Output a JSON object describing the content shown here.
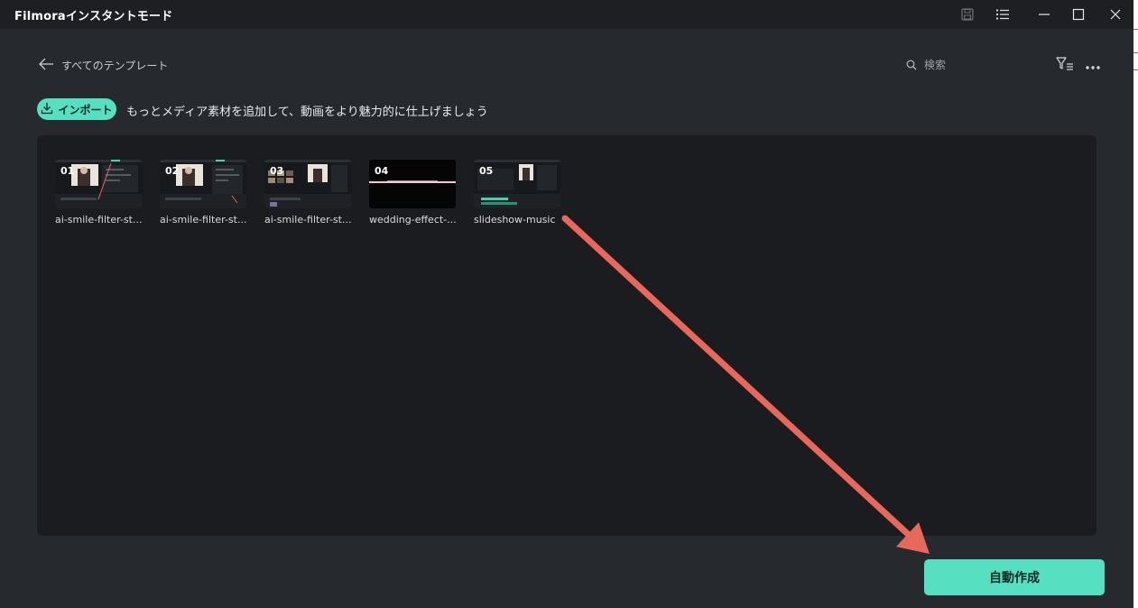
{
  "titlebar": {
    "title": "Filmoraインスタントモード",
    "icons": [
      "save-icon",
      "list-menu-icon",
      "minimize-icon",
      "maximize-icon",
      "close-icon"
    ]
  },
  "header": {
    "back_label": "すべてのテンプレート",
    "search_placeholder": "検索"
  },
  "import": {
    "button_label": "インポート",
    "hint": "もっとメディア素材を追加して、動画をより魅力的に仕上げましょう"
  },
  "media": {
    "items": [
      {
        "number": "01",
        "name": "ai-smile-filter-st..."
      },
      {
        "number": "02",
        "name": "ai-smile-filter-st..."
      },
      {
        "number": "03",
        "name": "ai-smile-filter-st..."
      },
      {
        "number": "04",
        "name": "wedding-effect-..."
      },
      {
        "number": "05",
        "name": "slideshow-music"
      }
    ]
  },
  "actions": {
    "create_label": "自動作成"
  },
  "colors": {
    "accent": "#56dfc0",
    "window_bg": "#26292e",
    "panel_bg": "#1a1c20",
    "annotation_arrow": "#e8685c"
  }
}
